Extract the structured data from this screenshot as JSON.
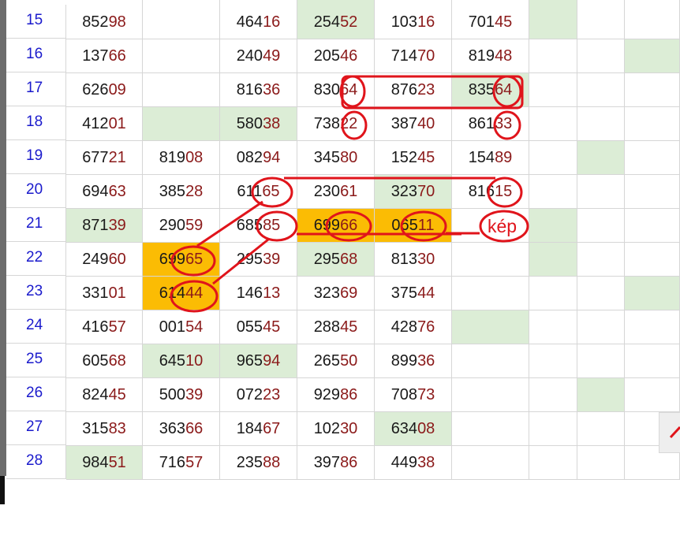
{
  "sheet": {
    "rows": [
      {
        "label": "15",
        "cells": [
          "85298",
          "",
          "46416",
          "25452",
          "10316",
          "70145",
          "",
          "",
          ""
        ],
        "fills": [
          "",
          "",
          "",
          "g",
          "",
          "",
          "g",
          "",
          ""
        ]
      },
      {
        "label": "16",
        "cells": [
          "13766",
          "",
          "24049",
          "20546",
          "71470",
          "81948",
          "",
          "",
          ""
        ],
        "fills": [
          "",
          "",
          "",
          "",
          "",
          "",
          "",
          "",
          "g"
        ]
      },
      {
        "label": "17",
        "cells": [
          "62609",
          "",
          "81636",
          "83064",
          "87623",
          "83564",
          "",
          "",
          ""
        ],
        "fills": [
          "",
          "",
          "",
          "",
          "",
          "g",
          "",
          "",
          ""
        ]
      },
      {
        "label": "18",
        "cells": [
          "41201",
          "",
          "58038",
          "73822",
          "38740",
          "86133",
          "",
          "",
          ""
        ],
        "fills": [
          "",
          "g",
          "g",
          "",
          "",
          "",
          "",
          "",
          ""
        ]
      },
      {
        "label": "19",
        "cells": [
          "67721",
          "81908",
          "08294",
          "34580",
          "15245",
          "15489",
          "",
          "",
          ""
        ],
        "fills": [
          "",
          "",
          "",
          "",
          "",
          "",
          "",
          "g",
          ""
        ]
      },
      {
        "label": "20",
        "cells": [
          "69463",
          "38528",
          "61165",
          "23061",
          "32370",
          "81615",
          "",
          "",
          ""
        ],
        "fills": [
          "",
          "",
          "",
          "",
          "g",
          "",
          "",
          "",
          ""
        ]
      },
      {
        "label": "21",
        "cells": [
          "87139",
          "29059",
          "68585",
          "69966",
          "06511",
          "",
          "",
          "",
          ""
        ],
        "fills": [
          "g",
          "",
          "",
          "o",
          "o",
          "",
          "g",
          "",
          ""
        ]
      },
      {
        "label": "22",
        "cells": [
          "24960",
          "69965",
          "29539",
          "29568",
          "81330",
          "",
          "",
          "",
          ""
        ],
        "fills": [
          "",
          "o",
          "",
          "g",
          "",
          "",
          "g",
          "",
          ""
        ]
      },
      {
        "label": "23",
        "cells": [
          "33101",
          "61444",
          "14613",
          "32369",
          "37544",
          "",
          "",
          "",
          ""
        ],
        "fills": [
          "",
          "o",
          "",
          "",
          "",
          "",
          "",
          "",
          "g"
        ]
      },
      {
        "label": "24",
        "cells": [
          "41657",
          "00154",
          "05545",
          "28845",
          "42876",
          "",
          "",
          "",
          ""
        ],
        "fills": [
          "",
          "",
          "",
          "",
          "",
          "g",
          "",
          "",
          ""
        ]
      },
      {
        "label": "25",
        "cells": [
          "60568",
          "64510",
          "96594",
          "26550",
          "89936",
          "",
          "",
          "",
          ""
        ],
        "fills": [
          "",
          "g",
          "g",
          "",
          "",
          "",
          "",
          "",
          ""
        ]
      },
      {
        "label": "26",
        "cells": [
          "82445",
          "50039",
          "07223",
          "92986",
          "70873",
          "",
          "",
          "",
          ""
        ],
        "fills": [
          "",
          "",
          "",
          "",
          "",
          "",
          "",
          "g",
          ""
        ]
      },
      {
        "label": "27",
        "cells": [
          "31583",
          "36366",
          "18467",
          "10230",
          "63408",
          "",
          "",
          "",
          ""
        ],
        "fills": [
          "",
          "",
          "",
          "",
          "g",
          "",
          "",
          "",
          ""
        ]
      },
      {
        "label": "28",
        "cells": [
          "98451",
          "71657",
          "23588",
          "39786",
          "44938",
          "",
          "",
          "",
          ""
        ],
        "fills": [
          "g",
          "",
          "",
          "",
          "",
          "",
          "",
          "",
          ""
        ]
      }
    ]
  },
  "annotation": {
    "label": "kép"
  },
  "colors": {
    "highlight_green": "#dcedd6",
    "highlight_orange": "#fbbc04",
    "annotation_red": "#e0141b",
    "row_number": "#1a1acc",
    "tail_digits": "#8b1a1a"
  }
}
